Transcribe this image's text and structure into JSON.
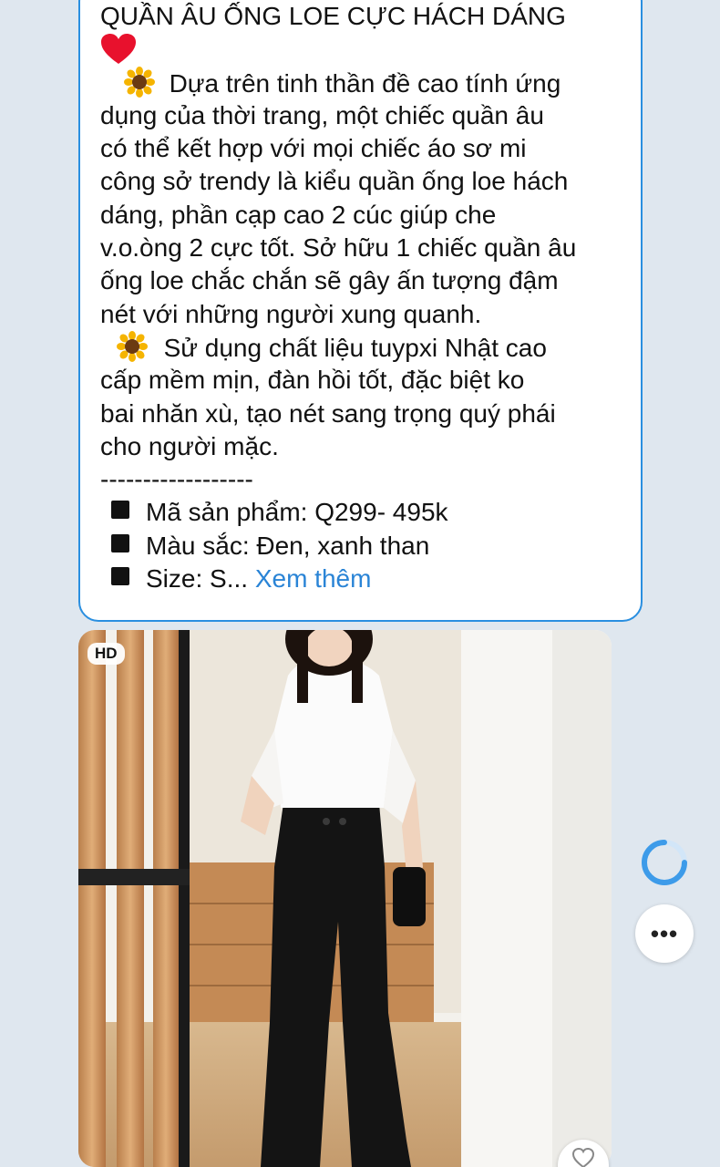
{
  "message": {
    "title": "QUẦN ÂU ỐNG LOE CỰC HÁCH DÁNG",
    "emojis": {
      "heart": "heart-icon",
      "flower": "sunflower-icon"
    },
    "lines_paragraph1": [
      "Dựa trên tinh thần đề cao tính ứng",
      "dụng của thời trang, một chiếc quần âu",
      "có thể kết hợp với mọi chiếc áo sơ mi",
      "công sở trendy là kiểu quần ống loe hách",
      "dáng, phần cạp cao 2 cúc giúp che",
      "v.o.òng 2 cực tốt. Sở hữu 1 chiếc quần âu",
      "ống loe chắc chắn sẽ gây ấn tượng đậm",
      "nét với những người xung quanh."
    ],
    "lines_paragraph2": [
      "Sử dụng chất liệu tuypxi Nhật cao",
      "cấp mềm mịn, đàn hồi tốt, đặc biệt ko",
      "bai nhăn xù, tạo nét sang trọng quý phái",
      "cho người mặc."
    ],
    "divider": "------------------",
    "bullets": [
      "Mã sản phẩm: Q299- 495k",
      "Màu sắc: Đen, xanh than",
      "Size: S..."
    ],
    "see_more": "Xem thêm"
  },
  "photo": {
    "badge": "HD",
    "description_icon": "product-photo"
  },
  "controls": {
    "more_label": "•••",
    "spinner_icon": "loading-spinner-icon",
    "react_icon": "heart-outline-icon"
  },
  "colors": {
    "bubble_border": "#2a8fe0",
    "link": "#2a84d6",
    "background": "#dfe7ef"
  }
}
